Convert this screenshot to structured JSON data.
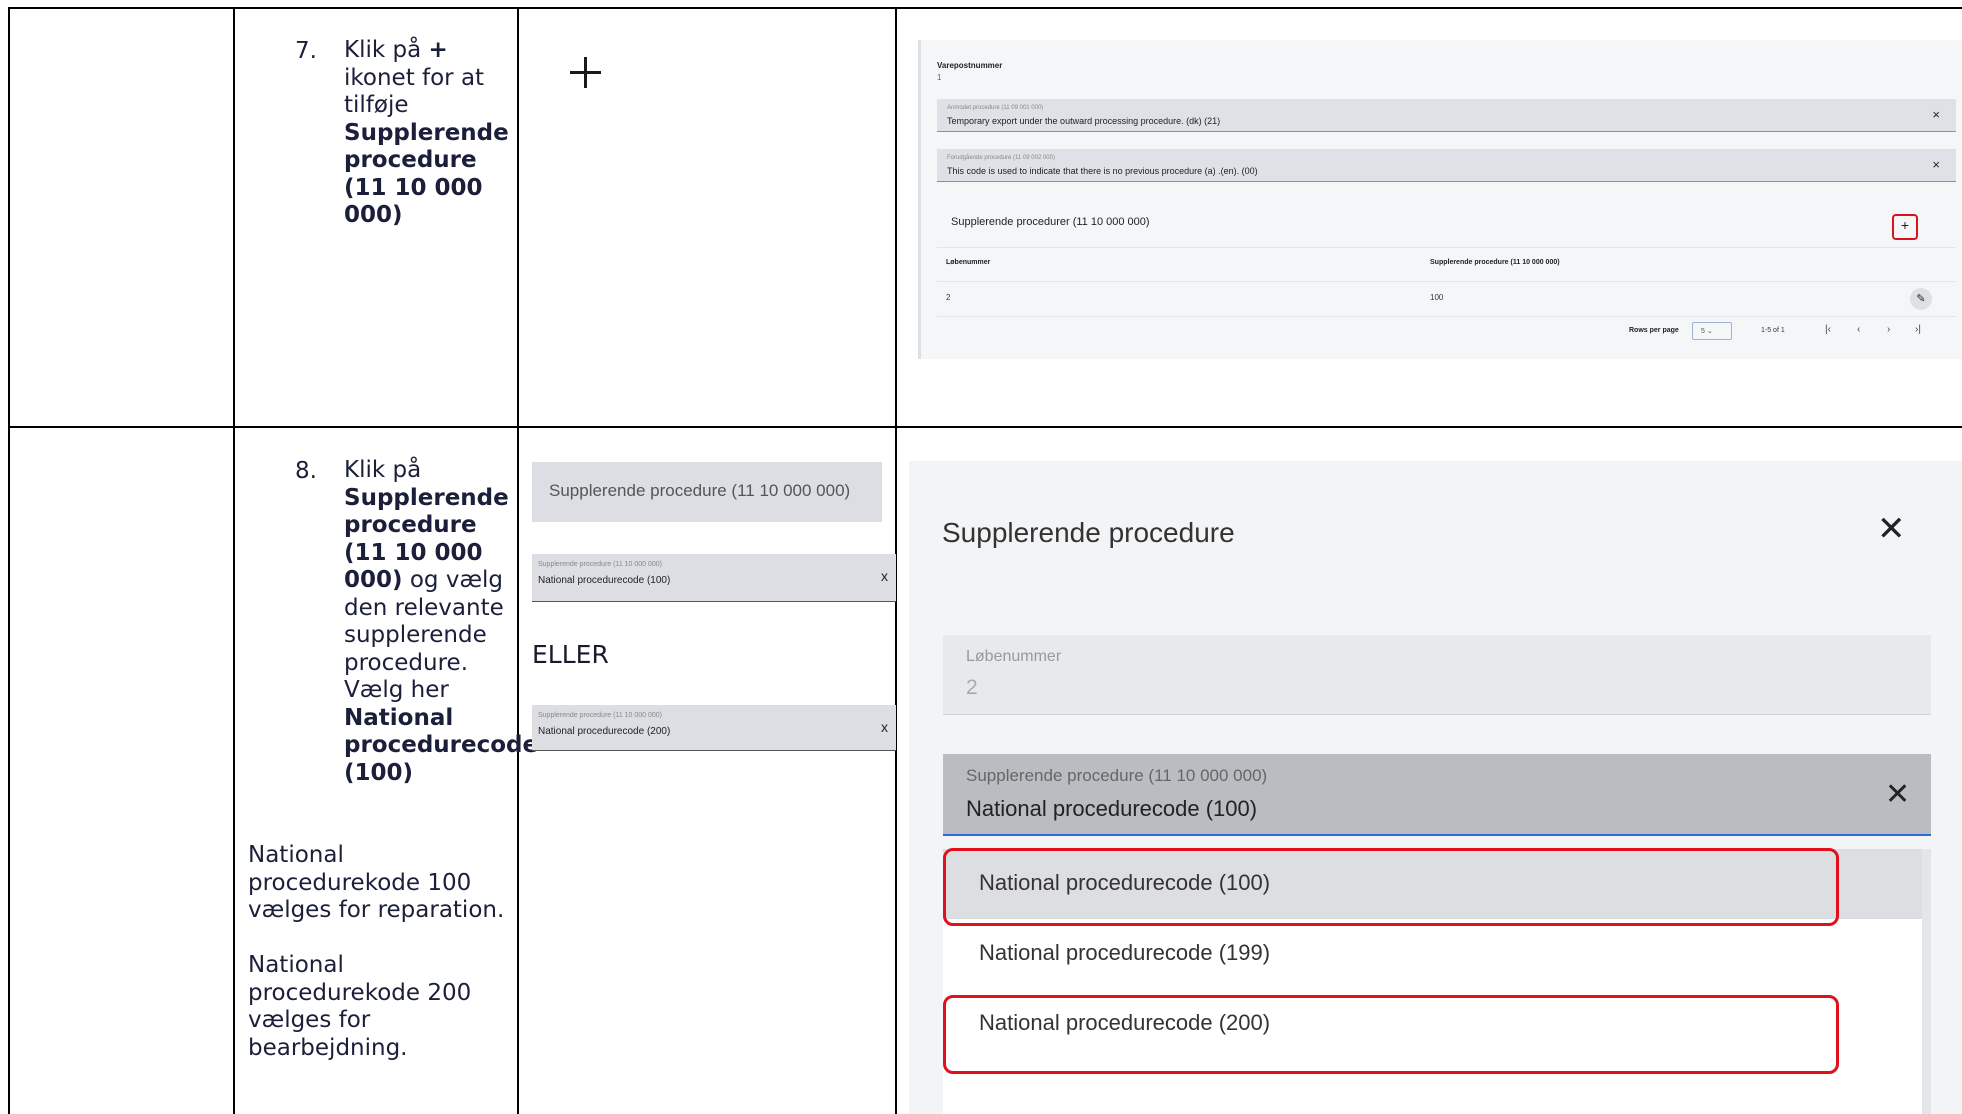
{
  "step7": {
    "number": "7.",
    "text1": "Klik på",
    "plus_bold": "+",
    "text2": "ikonet for at tilføje",
    "bold": "Supplerende procedure (11 10 000 000)"
  },
  "step8": {
    "number": "8.",
    "text1": "Klik på",
    "bold1": "Supplerende procedure (11 10 000 000)",
    "text2": "og vælg den relevante supplerende procedure. Vælg her",
    "bold2": "National procedurecode (100)",
    "note1": "National procedurekode 100 vælges for reparation.",
    "note2": "National procedurekode 200 vælges for bearbejdning."
  },
  "shot1": {
    "varepost_label": "Varepostnummer",
    "varepost_value": "1",
    "field1_label": "Anmodet procedure (11 09 001 000)",
    "field1_value": "Temporary export under the outward processing procedure. (dk) (21)",
    "field2_label": "Forudgående procedure (11 09 002 000)",
    "field2_value": "This code is used to indicate that there is no previous procedure (a) .(en). (00)",
    "close_glyph": "×",
    "section_title": "Supplerende procedurer (11 10 000 000)",
    "add_glyph": "+",
    "col1": "Løbenummer",
    "col2": "Supplerende procedure (11 10 000 000)",
    "row_col1": "2",
    "row_col2": "100",
    "edit_glyph": "✎",
    "rows_per_page_label": "Rows per page",
    "rows_per_page_value": "5 ⌄",
    "range": "1-5 of 1",
    "pg_first": "|‹",
    "pg_prev": "‹",
    "pg_next": "›",
    "pg_last": "›|"
  },
  "mid": {
    "button_label": "Supplerende procedure (11 10 000 000)",
    "mini1_label": "Supplerende procedure (11 10 000 000)",
    "mini1_value": "National procedurecode (100)",
    "eller": "ELLER",
    "mini2_label": "Supplerende procedure (11 10 000 000)",
    "mini2_value": "National procedurecode (200)",
    "close_x": "x"
  },
  "dialog": {
    "title": "Supplerende procedure",
    "close_glyph": "✕",
    "lob_label": "Løbenummer",
    "lob_value": "2",
    "select_label": "Supplerende procedure (11 10 000 000)",
    "select_value": "National procedurecode  (100)",
    "options": [
      "National procedurecode (100)",
      "National procedurecode (199)",
      "National procedurecode (200)"
    ]
  }
}
